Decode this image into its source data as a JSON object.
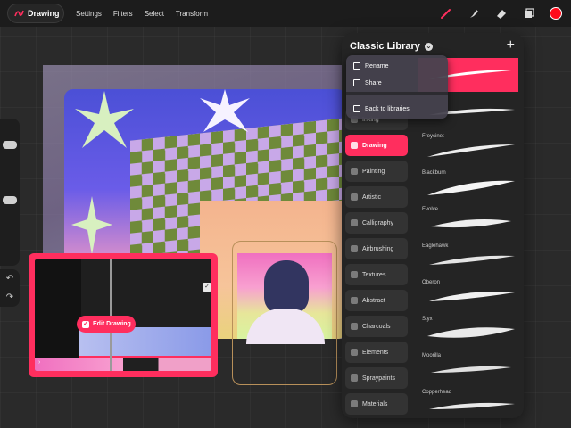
{
  "topbar": {
    "back_label": "Drawing",
    "menu": [
      "Settings",
      "Filters",
      "Select",
      "Transform"
    ],
    "tools": [
      "brush-icon",
      "smudge-icon",
      "eraser-icon",
      "layers-icon"
    ],
    "color": "#ff0a1a"
  },
  "rail": {
    "undo": "↶",
    "redo": "↷"
  },
  "preview": {
    "edit_label": "Edit Drawing",
    "corner": "›"
  },
  "library": {
    "title": "Classic Library",
    "add": "+",
    "categories": [
      {
        "label": "Inking"
      },
      {
        "label": "Drawing"
      },
      {
        "label": "Painting"
      },
      {
        "label": "Artistic"
      },
      {
        "label": "Calligraphy"
      },
      {
        "label": "Airbrushing"
      },
      {
        "label": "Textures"
      },
      {
        "label": "Abstract"
      },
      {
        "label": "Charcoals"
      },
      {
        "label": "Elements"
      },
      {
        "label": "Spraypaints"
      },
      {
        "label": "Materials"
      }
    ],
    "active_category": "Drawing",
    "brushes": [
      "Freycinet",
      "Blackburn",
      "Evolve",
      "Eaglehawk",
      "Oberon",
      "Styx",
      "Moorilla",
      "Copperhead"
    ]
  },
  "popover": {
    "rename": "Rename",
    "share": "Share",
    "back": "Back to libraries"
  },
  "colors": {
    "accent": "#ff2e5e",
    "panel": "#242424"
  }
}
